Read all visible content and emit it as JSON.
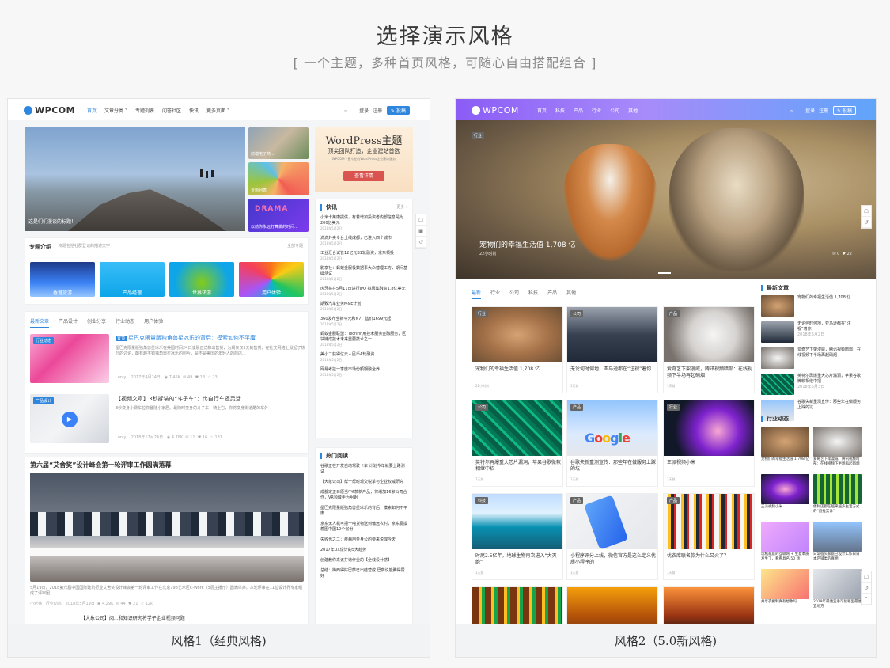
{
  "header": {
    "title": "选择演示风格",
    "subtitle": "[ 一个主题，多种首页风格，可随心自由搭配组合 ]"
  },
  "styles": [
    {
      "caption": "风格1（经典风格)",
      "logo": "WPCOM",
      "nav": [
        "首页",
        "文章分类 ˅",
        "专题列表",
        "问答社区",
        "快讯",
        "更多页面 ˅"
      ],
      "nav_right": {
        "login": "登录",
        "register": "注册",
        "post": "投稿"
      },
      "hero_caption": "这是们们漫谈的标题！",
      "side_tiles": [
        "前端电子商...",
        "专题列表",
        "以前你永远打算做的时间..."
      ],
      "ad": {
        "title": "WordPress主题",
        "sub": "顶尖团队打造，企业建站首选",
        "small": "WPCOM · 更专业的WordPress企业建站服务",
        "button": "查看详情"
      },
      "topics": {
        "title": "专题介绍",
        "desc": "专题包括社群登记的描述文字",
        "more": "全部专题",
        "items": [
          "香港旅游",
          "产品经理",
          "世界环游",
          "用户体验"
        ]
      },
      "tabs": [
        "最新文章",
        "产品设计",
        "创业分享",
        "行业动态",
        "用户体验"
      ],
      "articles": [
        {
          "tag": "行业动态",
          "badge": "置顶",
          "title": "星巴克限量版独角兽星冰乐的背后：摸索如何不平庸",
          "excerpt": "星巴克限量版独角兽星冰乐在美国时间24日凌晨正式推出售货，为期仅仅5天的售货，在社交网络上掀起了热烈的讨论，酷有趣不错独角兽星冰乐的照片，是不是美国的年轻人的商店...",
          "author": "Lonly",
          "date": "2017年4月24日",
          "views": "7.45K",
          "comments": "49",
          "likes": "18",
          "extra": "23"
        },
        {
          "tag": "产品设计",
          "title": "【视频文章】3秒拆装的“斗子车”：比自行车还灵活",
          "excerpt": "3秒变身小费车拉你登陆小家居。最随时变身的斗子车，骑上它，你将变身街道酷的车外",
          "author": "Lonly",
          "date": "2018年12月24日",
          "views": "4.78K",
          "comments": "11",
          "likes": "16",
          "extra": "131"
        }
      ],
      "big_article": {
        "title": "第六届“艾舍奖”设计峰会第一轮评审工作圆满落幕",
        "excerpt": "5月19日，2018第六届中国国际建筑行业艾舍奖设计峰会第一轮评审工作在北京798艺术区C-Work（5层主播厅）圆满举办。本轮评审在11位设计界专家组成了评审团，...",
        "author": "小老猫",
        "category": "行业动态",
        "date": "2018年5月19日",
        "views": "4.29K",
        "comments": "44",
        "likes": "21",
        "extra": "12k"
      },
      "next_article": "【大象公司】阅...和知识研究将学子企业视频问题",
      "news": {
        "title": "快讯",
        "more": "更多 ›",
        "items": [
          {
            "t": "小米卡莱康提供，有着增加投资者内部信息是为200亿美元",
            "d": "2018年5月2日"
          },
          {
            "t": "滴滴外卖令台上线成都，已进入四个城市",
            "d": "2018年5月2日"
          },
          {
            "t": "工业汇合试管12亿元B1轮融资，京东领投",
            "d": "2018年5月2日"
          },
          {
            "t": "影享社：蚂蚁金服极数据事大众营理工方，期间基础测试",
            "d": "2018年5月2日"
          },
          {
            "t": "虎牙将在5月11日进行IPO 拟募集融资1.8亿美元",
            "d": "2018年5月2日"
          },
          {
            "t": "期致汽车业务M&E计划",
            "d": "2018年5月2日"
          },
          {
            "t": "360发布全新平元和N7，售价1699元起",
            "d": "2018年5月2日"
          },
          {
            "t": "蚂蚁金服联盟：TechFin用技术服务金融服务，区块链成技术未来重要技术之一",
            "d": "2018年5月2日"
          },
          {
            "t": "美小二获得亿元人民币A轮融资",
            "d": "2018年5月2日"
          },
          {
            "t": "网易考拉一季度市场份额期融全养",
            "d": "2018年5月2日"
          }
        ]
      },
      "hot": {
        "title": "热门阅读",
        "items": [
          "谷歌正在开发自动驾驶卡车 计划今年就要上路测试",
          "【大象公司】帮一帮时现交税季与企业权威研究",
          "成都定正日原当中6款新产品，将增加16家公司合作，VR领域更为明朗",
          "星巴克限量版独角兽星冰乐的背后：摸索如何不平庸",
          "京东无人机可把一吨货物送到偏远农村，京东要摸着图中国10个省份",
          "失败也之二：疾病用金身公的要来说理今天",
          "2017年UX设计的5大趋势",
          "创建教你来该打谱作业的【全线设计感】",
          "总结：梅西得好巴萨已出结营成 巴萨说能腾得赞好"
        ]
      },
      "side_icons": [
        "☖",
        "▣",
        "↺"
      ]
    },
    {
      "caption": "风格2（5.0新风格)",
      "logo": "WPCOM",
      "nav": [
        "首页",
        "科技",
        "产品",
        "行业",
        "公司",
        "其他"
      ],
      "nav_right": {
        "login": "登录",
        "register": "注册",
        "post": "投稿"
      },
      "hero": {
        "tag": "行业",
        "title": "宠物们的幸福生活值 1,708 亿",
        "time": "22小时前",
        "comments": "0",
        "likes": "22"
      },
      "tabs": [
        "最新",
        "行业",
        "公司",
        "科技",
        "产品",
        "其他"
      ],
      "grid": [
        {
          "tag": "行业",
          "title": "宠物们的幸福生活值 1,708 亿",
          "time": "22小时前"
        },
        {
          "tag": "公司",
          "title": "无论何时何地，亚马逊都在“注视”着你",
          "time": "1天前"
        },
        {
          "tag": "产品",
          "title": "爱奇艺下架漫威，腾讯视频暗部：在线视频下半场再起硝烟",
          "time": "1天前"
        },
        {
          "tag": "公司",
          "title": "英特尔再爆重大芯片漏洞，苹果谷歌微软相继中招",
          "time": "1天前"
        },
        {
          "tag": "产品",
          "title": "谷歌失新重测宣传：那些年在做服务上踩的坑",
          "time": "1天前"
        },
        {
          "tag": "行业",
          "title": "王派视频小米",
          "time": "1天前"
        },
        {
          "tag": "科技",
          "title": "时尾2.5亿年，地球生物再次进入“大灭绝”",
          "time": "1天前"
        },
        {
          "tag": "产品",
          "title": "小程序评分上线，微信官方是这么定义优质小程序的",
          "time": "1天前"
        },
        {
          "tag": "产品",
          "title": "优衣库联名款为什么又火了？",
          "time": "1天前"
        }
      ],
      "latest": {
        "title": "最新文章",
        "items": [
          "宠物们的幸福生活值 1,708 亿",
          "无论何时何地，亚马逊都在“注视”着你",
          "爱奇艺下架漫威，腾讯视频暗部：在线视频下半场再起硝烟",
          "英特尔再爆重大芯片漏洞，苹果谷歌微软相继中招",
          "谷歌失新重测宣传：那些年在做服务上踩的坑"
        ],
        "dates": [
          "",
          "2018年5月2日",
          "",
          "2018年5月3日",
          ""
        ]
      },
      "industry": {
        "title": "行业动态",
        "items": [
          "宠物们的幸福生活值 1,708 亿",
          "爱奇艺下架漫威，腾讯视频暗部：在线视频下半场再起硝烟",
          "王派视频小米",
          "便利店都在越来越多生活方式的“首推实体”",
          "玩机家庭的互联网 + 生意本质发生了，看看具名 50 场",
          "日常宿头家庭已设计工作日日本店铺类的真相",
          "共享衣橱制真有想象吗",
          "2019年最便宜手可能哪里最便宜地方"
        ]
      },
      "side_icons": [
        "☖",
        "↺"
      ],
      "side_icons_b": [
        "☖",
        "↺",
        "⌃"
      ]
    }
  ],
  "colors": {
    "accent": "#2e86de",
    "gradient_start": "#8b5cf6",
    "gradient_end": "#60a5fa",
    "ad_button": "#d9534f"
  }
}
